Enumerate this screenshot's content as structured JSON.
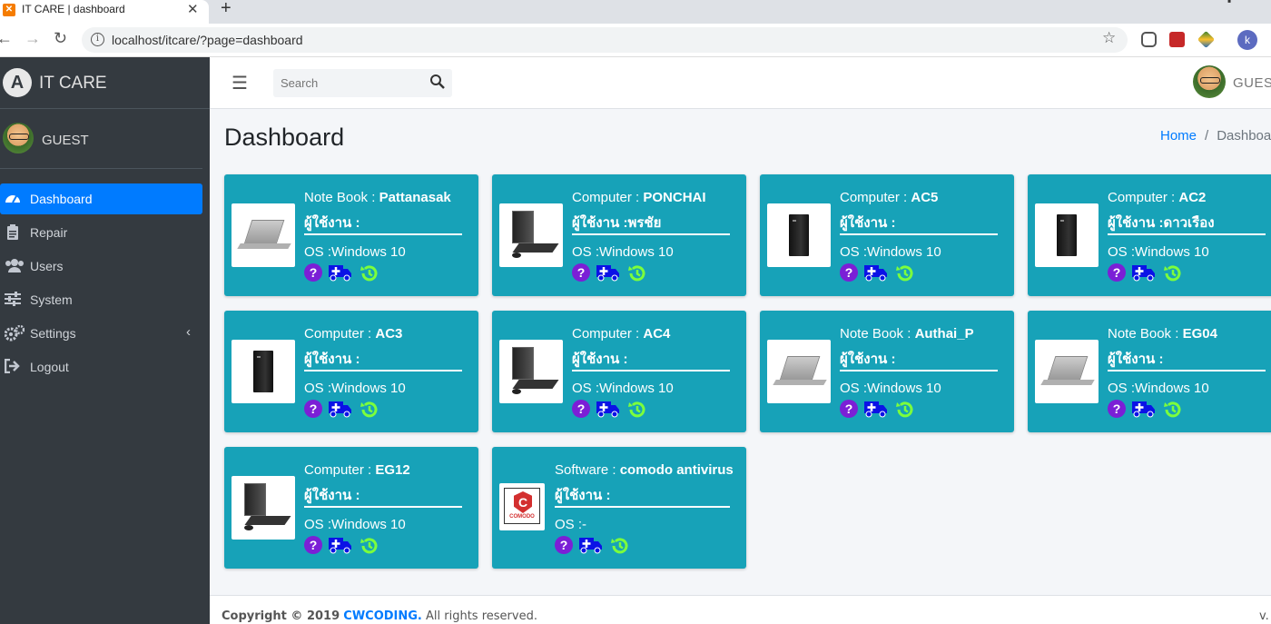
{
  "browser": {
    "tab_title": "IT CARE | dashboard",
    "tab_close": "✕",
    "new_tab": "+",
    "url": "localhost/itcare/?page=dashboard",
    "profile_initial": "k"
  },
  "sidebar": {
    "brand": "IT CARE",
    "user": "GUEST",
    "items": [
      {
        "label": "Dashboard",
        "icon": "dashboard-gauge-icon",
        "active": true
      },
      {
        "label": "Repair",
        "icon": "clipboard-icon"
      },
      {
        "label": "Users",
        "icon": "users-icon"
      },
      {
        "label": "System",
        "icon": "sliders-icon"
      },
      {
        "label": "Settings",
        "icon": "cogs-icon"
      },
      {
        "label": "Logout",
        "icon": "logout-icon"
      }
    ]
  },
  "header": {
    "search_placeholder": "Search",
    "user": "GUEST"
  },
  "page": {
    "title": "Dashboard",
    "breadcrumb": {
      "home": "Home",
      "sep": "/",
      "current": "Dashboard"
    }
  },
  "colors": {
    "card": "#17a2b8",
    "sidebar": "#343a40",
    "active": "#007bff",
    "help_icon": "#7b1fd6",
    "ambulance_icon": "#0b12e6",
    "history_icon": "#7cff3c"
  },
  "devices": [
    {
      "type": "Note Book",
      "name": "Pattanasak",
      "user_label": "ผู้ใช้งาน :",
      "os": "OS :Windows 10",
      "image": "laptop"
    },
    {
      "type": "Computer",
      "name": "PONCHAI",
      "user_label": "ผู้ใช้งาน :พรชัย",
      "os": "OS :Windows 10",
      "image": "desktop-set"
    },
    {
      "type": "Computer",
      "name": "AC5",
      "user_label": "ผู้ใช้งาน :",
      "os": "OS :Windows 10",
      "image": "tower"
    },
    {
      "type": "Computer",
      "name": "AC2",
      "user_label": "ผู้ใช้งาน :ดาวเรือง",
      "os": "OS :Windows 10",
      "image": "tower"
    },
    {
      "type": "Computer",
      "name": "AC3",
      "user_label": "ผู้ใช้งาน :",
      "os": "OS :Windows 10",
      "image": "tower"
    },
    {
      "type": "Computer",
      "name": "AC4",
      "user_label": "ผู้ใช้งาน :",
      "os": "OS :Windows 10",
      "image": "desktop-set"
    },
    {
      "type": "Note Book",
      "name": "Authai_P",
      "user_label": "ผู้ใช้งาน :",
      "os": "OS :Windows 10",
      "image": "laptop"
    },
    {
      "type": "Note Book",
      "name": "EG04",
      "user_label": "ผู้ใช้งาน :",
      "os": "OS :Windows 10",
      "image": "laptop"
    },
    {
      "type": "Computer",
      "name": "EG12",
      "user_label": "ผู้ใช้งาน :",
      "os": "OS :Windows 10",
      "image": "desktop-set"
    },
    {
      "type": "Software",
      "name": "comodo antivirus",
      "user_label": "ผู้ใช้งาน :",
      "os": "OS :-",
      "image": "comodo",
      "logo_text": "COMODO"
    }
  ],
  "footer": {
    "copyright_prefix": "Copyright © 2019",
    "brand": "CWCODING.",
    "suffix": "All rights reserved.",
    "version": "v."
  }
}
